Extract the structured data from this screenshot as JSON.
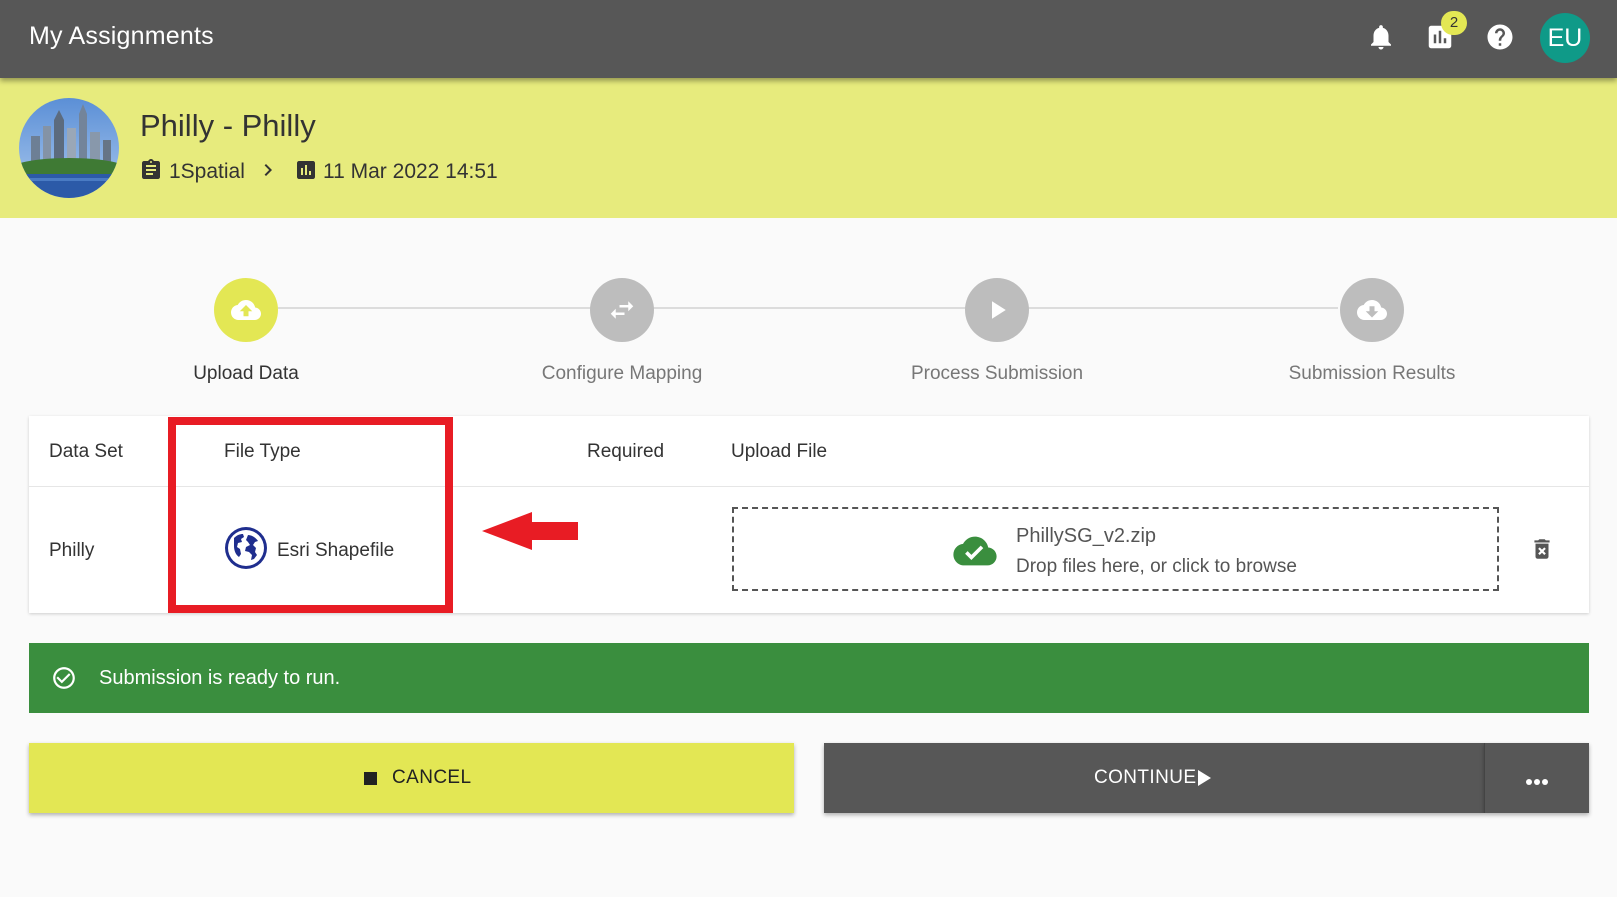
{
  "header": {
    "title": "My Assignments",
    "icons": [
      "bell-icon",
      "bar-chart-icon",
      "help-icon"
    ],
    "notification_count": "2",
    "user_initials": "EU",
    "colors": {
      "bar": "#575757",
      "badge": "#e3e754",
      "avatar": "#0f9a88"
    }
  },
  "project": {
    "title": "Philly - Philly",
    "organization": "1Spatial",
    "date": "11 Mar 2022 14:51",
    "banner_color": "#e7eb7d"
  },
  "stepper": {
    "steps": [
      {
        "label": "Upload Data",
        "icon": "cloud-upload-icon",
        "active": true
      },
      {
        "label": "Configure Mapping",
        "icon": "swap-arrows-icon",
        "active": false
      },
      {
        "label": "Process Submission",
        "icon": "play-icon",
        "active": false
      },
      {
        "label": "Submission Results",
        "icon": "cloud-download-icon",
        "active": false
      }
    ]
  },
  "table": {
    "columns": [
      "Data Set",
      "File Type",
      "Required",
      "Upload File"
    ],
    "rows": [
      {
        "data_set": "Philly",
        "file_type": "Esri Shapefile",
        "required": "",
        "file_name": "PhillySG_v2.zip",
        "drop_hint": "Drop files here, or click to browse"
      }
    ]
  },
  "alert": {
    "message": "Submission is ready to run.",
    "color": "#3a8e3e"
  },
  "actions": {
    "cancel_label": "CANCEL",
    "continue_label": "CONTINUE",
    "more_icon": "more-horizontal-icon"
  },
  "annotation": {
    "highlight_color": "#e81c24"
  }
}
